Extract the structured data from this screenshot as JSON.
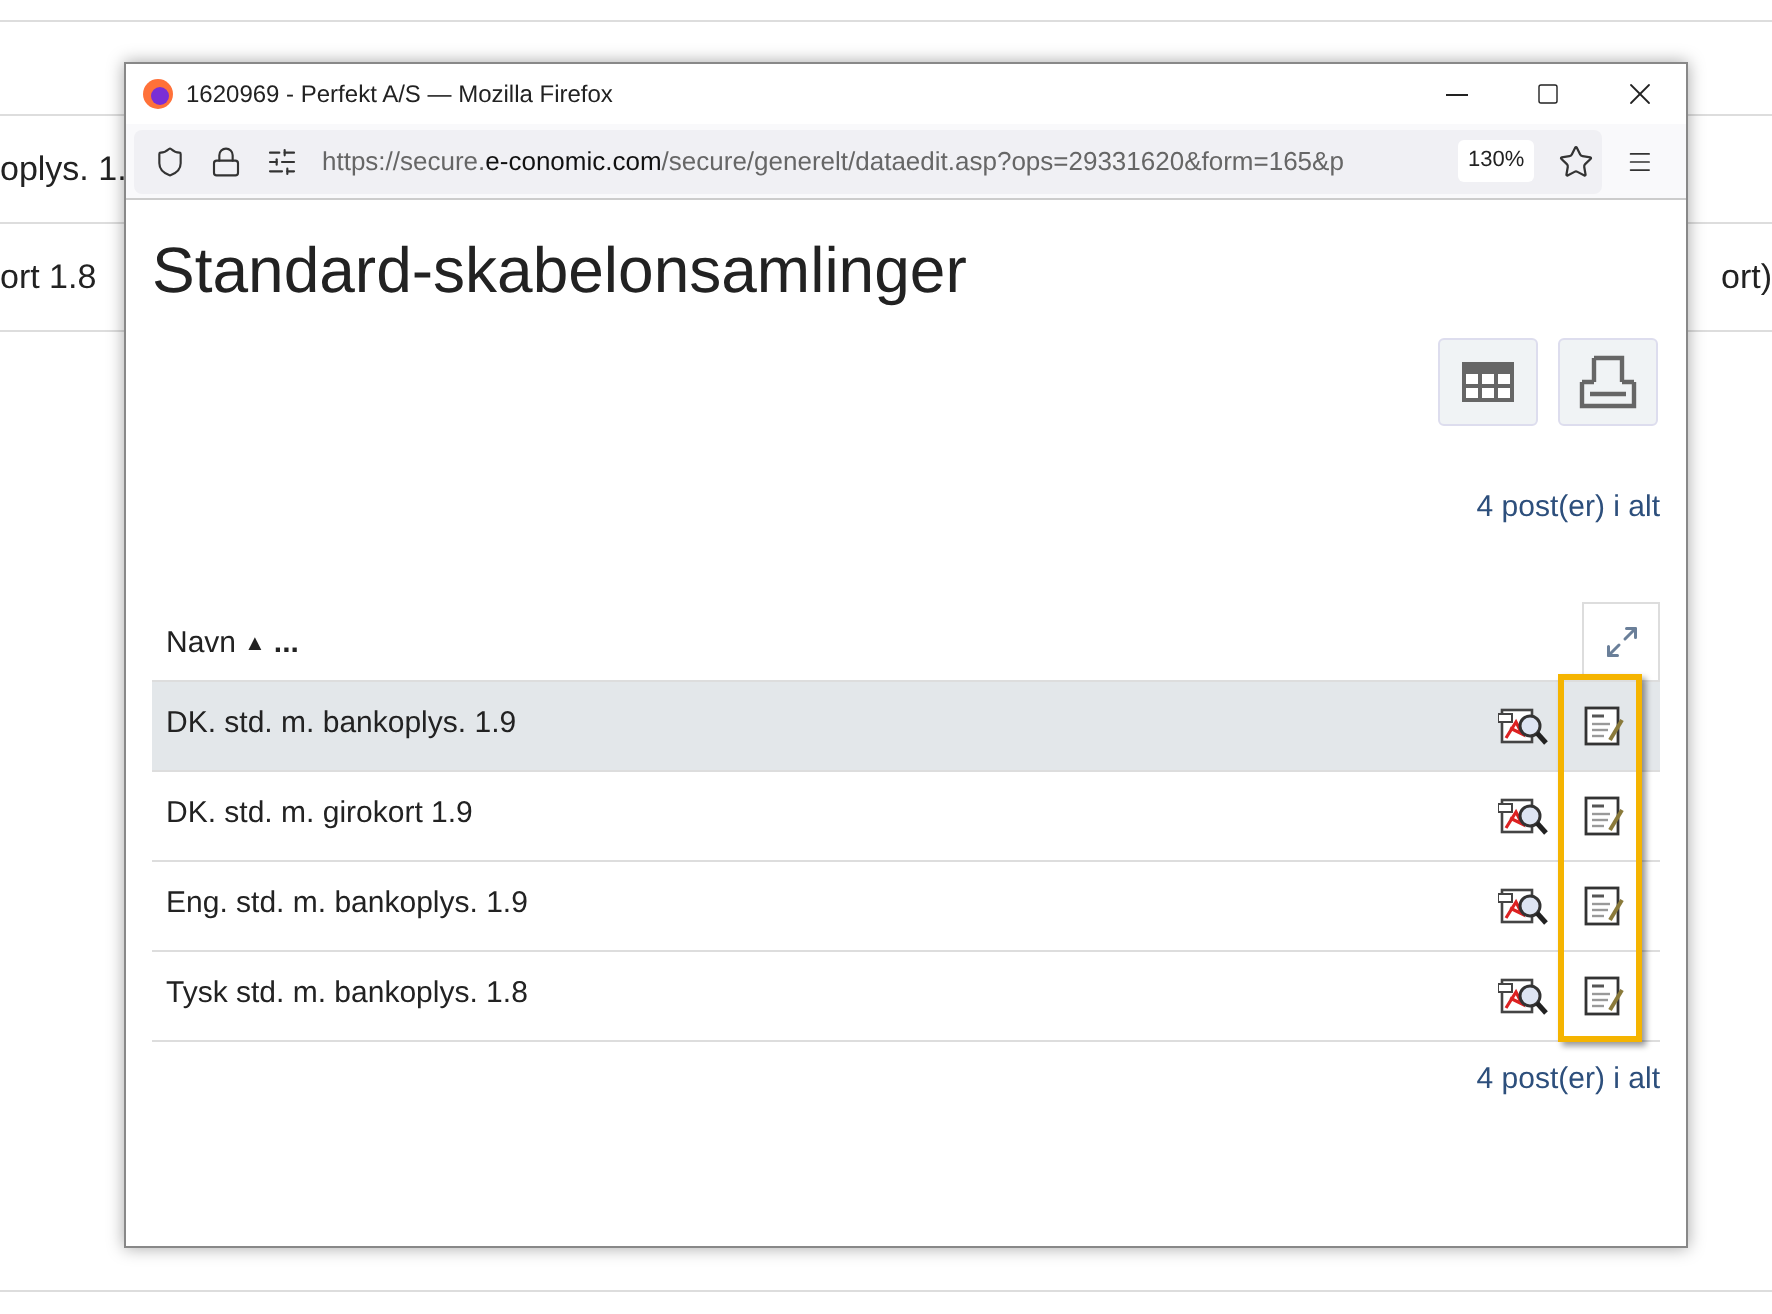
{
  "background": {
    "rows": [
      {
        "left": "oplys. 1."
      },
      {
        "left": "ort 1.8",
        "right": "ort)"
      }
    ]
  },
  "window": {
    "title": "1620969 - Perfekt A/S — Mozilla Firefox",
    "url": {
      "prefix": "https://secure.",
      "host": "e-conomic.com",
      "path": "/secure/generelt/dataedit.asp?ops=29331620&form=165&p"
    },
    "zoom": "130%"
  },
  "page": {
    "title": "Standard-skabelonsamlinger",
    "count_top": "4 post(er) i alt",
    "column": "Navn",
    "sort": "▲",
    "more": "...",
    "rows": [
      {
        "name": "DK. std. m. bankoplys. 1.9",
        "selected": true
      },
      {
        "name": "DK. std. m. girokort 1.9",
        "selected": false
      },
      {
        "name": "Eng. std. m. bankoplys. 1.9",
        "selected": false
      },
      {
        "name": "Tysk std. m. bankoplys. 1.8",
        "selected": false
      }
    ],
    "count_bottom": "4 post(er) i alt",
    "highlight_edit_column": true
  }
}
